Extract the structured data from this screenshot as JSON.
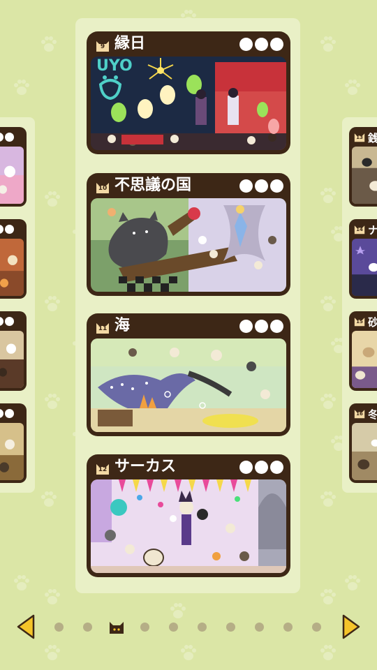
{
  "stages_main": [
    {
      "number": "9",
      "title": "縁日"
    },
    {
      "number": "10",
      "title": "不思議の国"
    },
    {
      "number": "11",
      "title": "海"
    },
    {
      "number": "12",
      "title": "サーカス"
    }
  ],
  "stages_right": [
    {
      "number": "13",
      "title": "銭"
    },
    {
      "number": "14",
      "title": "ナ"
    },
    {
      "number": "15",
      "title": "砂"
    },
    {
      "number": "16",
      "title": "冬"
    }
  ],
  "pager": {
    "total": 10,
    "current_index": 2
  },
  "colors": {
    "background": "#dbe6a6",
    "panel": "#e9f0c6",
    "card_frame": "#3d2716",
    "arrow": "#f5c42a",
    "pager_dot": "#b5ae86"
  },
  "icons": {
    "badge": "cat-head-icon",
    "prev": "left-arrow-icon",
    "next": "right-arrow-icon",
    "current_page": "cat-head-icon",
    "background": "paw-print-icon"
  }
}
